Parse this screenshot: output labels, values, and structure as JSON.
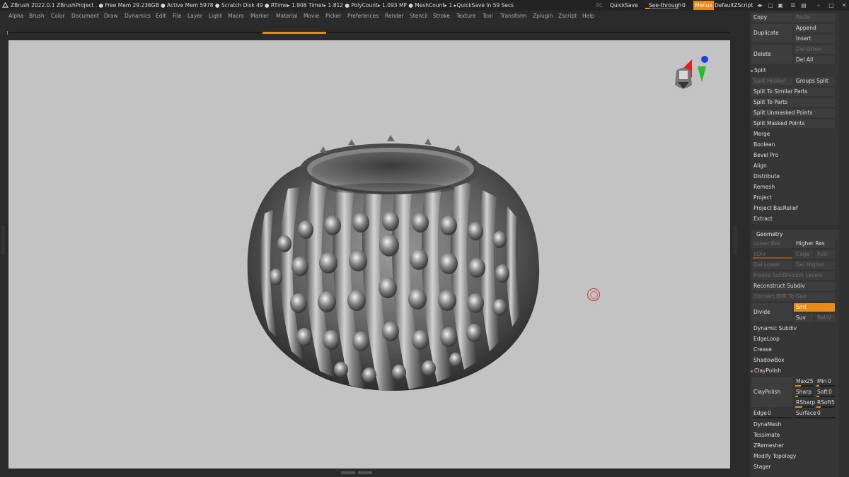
{
  "statusbar": {
    "status_text": "ZBrush 2022.0.1    ZBrushProject   . ● Free Mem 29.236GB ● Active Mem 5978 ● Scratch Disk 49 ●  RTime▸ 1.908 Timer▸ 1.812 ● PolyCount▸ 1.093 MP  ● MeshCount▸ 1   ▸QuickSave In 59 Secs",
    "ac": "AC",
    "quicksave": "QuickSave",
    "seethrough_label": "See-through",
    "seethrough_value": "0",
    "menus": "Menus",
    "default_script": "DefaultZScript"
  },
  "menubar": [
    "Alpha",
    "Brush",
    "Color",
    "Document",
    "Draw",
    "Dynamics",
    "Edit",
    "File",
    "Layer",
    "Light",
    "Macro",
    "Marker",
    "Material",
    "Movie",
    "Picker",
    "Preferences",
    "Render",
    "Stencil",
    "Stroke",
    "Texture",
    "Tool",
    "Transform",
    "Zplugin",
    "Zscript",
    "Help"
  ],
  "panel": {
    "copy": "Copy",
    "paste": "Paste",
    "duplicate": "Duplicate",
    "append": "Append",
    "insert": "Insert",
    "delete": "Delete",
    "del_other": "Del Other",
    "del_all": "Del All",
    "split": "Split",
    "split_hidden": "Split Hidden",
    "groups_split": "Groups Split",
    "split_similar": "Split To Similar Parts",
    "split_parts": "Split To Parts",
    "split_unmasked": "Split Unmasked Points",
    "split_masked": "Split Masked Points",
    "merge": "Merge",
    "boolean": "Boolean",
    "bevel_pro": "Bevel Pro",
    "align": "Align",
    "distribute": "Distribute",
    "remesh": "Remesh",
    "project": "Project",
    "project_basrelief": "Project BasRelief",
    "extract": "Extract",
    "geometry": "Geometry",
    "lower_res": "Lower Res",
    "higher_res": "Higher Res",
    "sdiv": "SDiv",
    "cage": "Cage",
    "rstr": "Rstr",
    "del_lower": "Del Lower",
    "del_higher": "Del Higher",
    "freeze": "Freeze SubDivision Levels",
    "reconstruct": "Reconstruct Subdiv",
    "convert_bpr": "Convert BPR To Geo",
    "divide": "Divide",
    "smt": "Smt",
    "suv": "Suv",
    "reuv": "ReUV",
    "dynamic_subdiv": "Dynamic Subdiv",
    "edgeloop": "EdgeLoop",
    "crease": "Crease",
    "shadowbox": "ShadowBox",
    "claypolish_header": "ClayPolish",
    "claypolish": "ClayPolish",
    "max_label": "Max",
    "max_value": "25",
    "min_label": "Min",
    "min_value": "0",
    "sharp_label": "Sharp",
    "soft_label": "Soft",
    "soft_value": "0",
    "rsharp_label": "RSharp",
    "rsoft_label": "RSoft",
    "rsoft_value": "5",
    "edge_label": "Edge",
    "edge_value": "0",
    "surface_label": "Surface",
    "surface_value": "0",
    "dynamesh": "DynaMesh",
    "tessimate": "Tessimate",
    "zremesher": "ZRemesher",
    "modify_topology": "Modify Topology",
    "stager": "Stager"
  },
  "sliders": {
    "max": 0.25,
    "seethrough": 0.1
  },
  "colors": {
    "accent": "#e88a1a",
    "canvas": "#c3c3c3",
    "panel": "#303030"
  },
  "icons": [
    "zbrush-logo-icon",
    "navigation-gizmo-icon",
    "target-circle-icon",
    "window-controls-icon"
  ]
}
